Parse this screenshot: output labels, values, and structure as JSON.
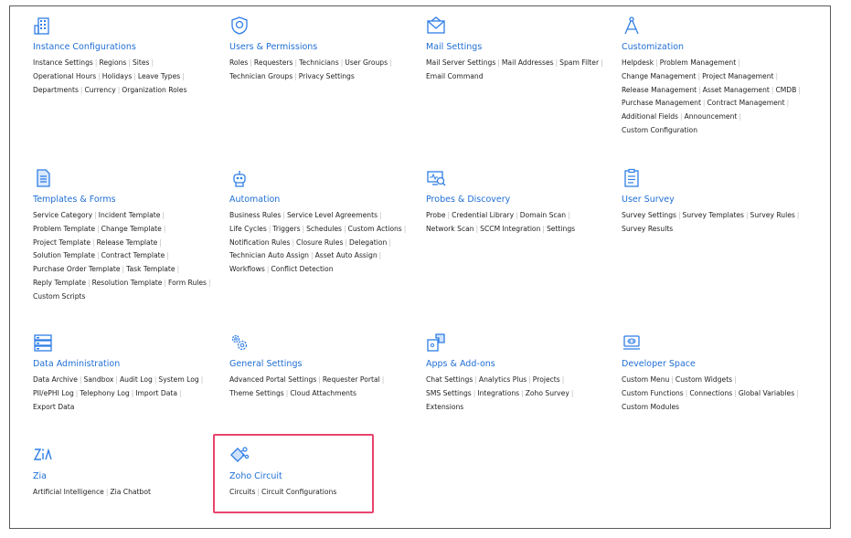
{
  "colors": {
    "accent": "#1f6ed4",
    "highlight": "#e8446d",
    "icon": "#2f7ee6"
  },
  "cards": [
    {
      "icon": "building-icon",
      "title": "Instance Configurations",
      "lines": [
        [
          "Instance Settings",
          "Regions",
          "Sites"
        ],
        [
          "Operational Hours",
          "Holidays",
          "Leave Types"
        ],
        [
          "Departments",
          "Currency",
          "Organization Roles"
        ]
      ]
    },
    {
      "icon": "shield-icon",
      "title": "Users & Permissions",
      "lines": [
        [
          "Roles",
          "Requesters",
          "Technicians",
          "User Groups"
        ],
        [
          "Technician Groups",
          "Privacy Settings"
        ]
      ]
    },
    {
      "icon": "envelope-icon",
      "title": "Mail Settings",
      "lines": [
        [
          "Mail Server Settings",
          "Mail Addresses",
          "Spam Filter"
        ],
        [
          "Email Command"
        ]
      ]
    },
    {
      "icon": "compass-icon",
      "title": "Customization",
      "lines": [
        [
          "Helpdesk",
          "Problem Management"
        ],
        [
          "Change Management",
          "Project Management"
        ],
        [
          "Release Management",
          "Asset Management",
          "CMDB"
        ],
        [
          "Purchase Management",
          "Contract Management"
        ],
        [
          "Additional Fields",
          "Announcement"
        ],
        [
          "Custom Configuration"
        ]
      ]
    },
    {
      "icon": "document-icon",
      "title": "Templates & Forms",
      "lines": [
        [
          "Service Category",
          "Incident Template"
        ],
        [
          "Problem Template",
          "Change Template"
        ],
        [
          "Project Template",
          "Release Template"
        ],
        [
          "Solution Template",
          "Contract Template"
        ],
        [
          "Purchase Order Template",
          "Task Template"
        ],
        [
          "Reply Template",
          "Resolution Template",
          "Form Rules"
        ],
        [
          "Custom Scripts"
        ]
      ]
    },
    {
      "icon": "robot-icon",
      "title": "Automation",
      "lines": [
        [
          "Business Rules",
          "Service Level Agreements"
        ],
        [
          "Life Cycles",
          "Triggers",
          "Schedules",
          "Custom Actions"
        ],
        [
          "Notification Rules",
          "Closure Rules",
          "Delegation"
        ],
        [
          "Technician Auto Assign",
          "Asset Auto Assign"
        ],
        [
          "Workflows",
          "Conflict Detection"
        ]
      ]
    },
    {
      "icon": "monitor-scan-icon",
      "title": "Probes & Discovery",
      "lines": [
        [
          "Probe",
          "Credential Library",
          "Domain Scan"
        ],
        [
          "Network Scan",
          "SCCM Integration",
          "Settings"
        ]
      ]
    },
    {
      "icon": "clipboard-icon",
      "title": "User Survey",
      "lines": [
        [
          "Survey Settings",
          "Survey Templates",
          "Survey Rules"
        ],
        [
          "Survey Results"
        ]
      ]
    },
    {
      "icon": "database-icon",
      "title": "Data Administration",
      "lines": [
        [
          "Data Archive",
          "Sandbox",
          "Audit Log",
          "System Log"
        ],
        [
          "PII/ePHI Log",
          "Telephony Log",
          "Import Data"
        ],
        [
          "Export Data"
        ]
      ]
    },
    {
      "icon": "gears-icon",
      "title": "General Settings",
      "lines": [
        [
          "Advanced Portal Settings",
          "Requester Portal"
        ],
        [
          "Theme Settings",
          "Cloud Attachments"
        ]
      ]
    },
    {
      "icon": "puzzle-icon",
      "title": "Apps & Add-ons",
      "lines": [
        [
          "Chat Settings",
          "Analytics Plus",
          "Projects"
        ],
        [
          "SMS Settings",
          "Integrations",
          "Zoho Survey"
        ],
        [
          "Extensions"
        ]
      ]
    },
    {
      "icon": "code-icon",
      "title": "Developer Space",
      "lines": [
        [
          "Custom Menu",
          "Custom Widgets"
        ],
        [
          "Custom Functions",
          "Connections",
          "Global Variables"
        ],
        [
          "Custom Modules"
        ]
      ]
    },
    {
      "icon": "zia-icon",
      "title": "Zia",
      "lines": [
        [
          "Artificial Intelligence",
          "Zia Chatbot"
        ]
      ]
    },
    {
      "icon": "circuit-icon",
      "title": "Zoho Circuit",
      "lines": [
        [
          "Circuits",
          "Circuit Configurations"
        ]
      ]
    }
  ]
}
